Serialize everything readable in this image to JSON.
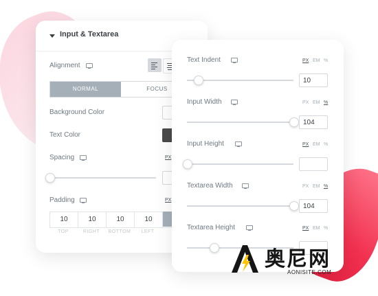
{
  "colors": {
    "accent_pink": "#f1304f",
    "tab_active": "#a4afb7",
    "text": "#6d7882",
    "title": "#3a3f45"
  },
  "left_panel": {
    "section_title": "Input & Textarea",
    "alignment_label": "Alignment",
    "tabs": [
      "NORMAL",
      "FOCUS"
    ],
    "background_color_label": "Background Color",
    "text_color_label": "Text Color",
    "text_color_value": "#4a4a4a",
    "spacing_label": "Spacing",
    "spacing_unit": "PX",
    "padding_label": "Padding",
    "padding_unit": "PX",
    "padding": {
      "values": [
        "10",
        "10",
        "10",
        "10"
      ],
      "captions": [
        "TOP",
        "RIGHT",
        "BOTTOM",
        "LEFT"
      ]
    }
  },
  "right_panel": {
    "units": [
      "PX",
      "EM",
      "%"
    ],
    "controls": [
      {
        "label": "Text Indent",
        "value": "10",
        "active_unit": "PX",
        "slider_level": 0.1
      },
      {
        "label": "Input Width",
        "value": "104",
        "active_unit": "%",
        "slider_level": 1.0
      },
      {
        "label": "Input Height",
        "value": "",
        "active_unit": "PX",
        "slider_level": 0.0
      },
      {
        "label": "Textarea Width",
        "value": "104",
        "active_unit": "%",
        "slider_level": 1.0
      },
      {
        "label": "Textarea Height",
        "value": "",
        "active_unit": "PX",
        "slider_level": 0.25
      }
    ]
  },
  "watermark": {
    "text": "奥尼网",
    "sub": "AONISITE.COM"
  }
}
